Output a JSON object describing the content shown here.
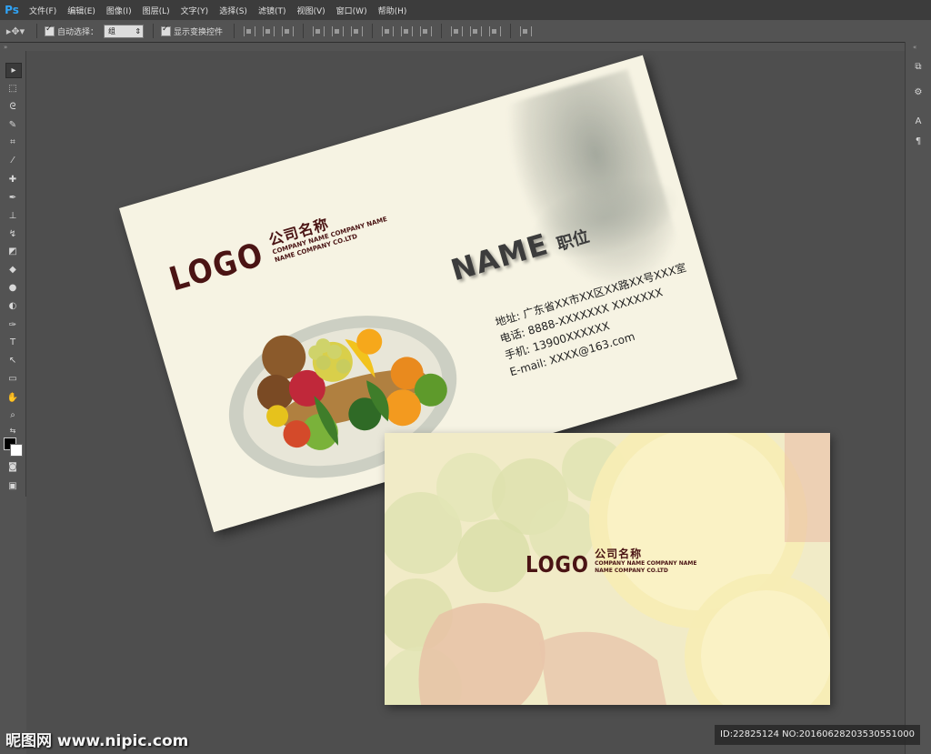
{
  "app": {
    "logo": "Ps"
  },
  "menu": [
    "文件(F)",
    "编辑(E)",
    "图像(I)",
    "图层(L)",
    "文字(Y)",
    "选择(S)",
    "滤镜(T)",
    "视图(V)",
    "窗口(W)",
    "帮助(H)"
  ],
  "options": {
    "auto_select_label": "自动选择：",
    "auto_select_value": "组",
    "show_transform_label": "显示变换控件"
  },
  "front_card": {
    "logo": "LOGO",
    "company_cn": "公司名称",
    "company_en_1": "COMPANY NAME COMPANY NAME",
    "company_en_2": "NAME COMPANY CO.LTD",
    "name": "NAME",
    "title": "职位",
    "address": "地址: 广东省XX市XX区XX路XX号XXX室",
    "phone": "电话: 8888-XXXXXXX   XXXXXXX",
    "mobile": "手机: 13900XXXXXX",
    "email": "E-mail: XXXX@163.com"
  },
  "back_card": {
    "logo": "LOGO",
    "company_cn": "公司名称",
    "company_en_1": "COMPANY NAME COMPANY NAME",
    "company_en_2": "NAME COMPANY CO.LTD"
  },
  "watermark": {
    "site": "昵图网 www.nipic.com",
    "id": "ID:22825124 NO:20160628203530551000"
  },
  "colors": {
    "brand_dark": "#4a1414",
    "card_bg": "#f6f3e3",
    "back_bg": "#f4eec9",
    "ui_bg": "#535353",
    "ps_blue": "#2fa3f6"
  }
}
